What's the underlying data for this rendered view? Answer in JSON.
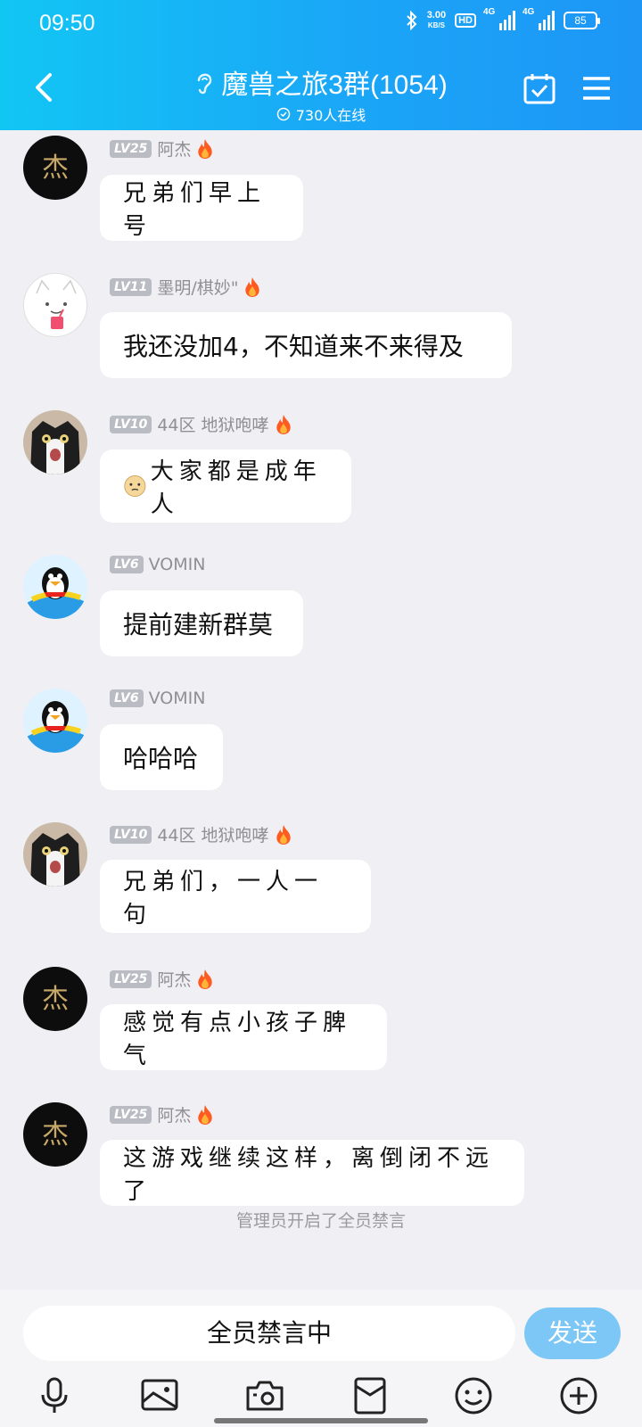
{
  "status_bar": {
    "time": "09:50",
    "speed": "3.00",
    "speed_unit": "KB/S",
    "hd": "HD",
    "net1": "4G",
    "net2": "4G",
    "battery": "85"
  },
  "header": {
    "title": "魔兽之旅3群(1054)",
    "online": "730人在线"
  },
  "messages": [
    {
      "level": "LV25",
      "name": "阿杰",
      "text": "兄弟们早上号",
      "style": "handwriting"
    },
    {
      "level": "LV11",
      "name": "墨明/棋妙\"",
      "text": "我还没加4，不知道来不来得及",
      "style": "normal"
    },
    {
      "level": "LV10",
      "name": "44区 地狱咆哮",
      "text": "大家都是成年人",
      "style": "handwriting"
    },
    {
      "level": "LV6",
      "name": "VOMIN",
      "text": "提前建新群莫",
      "style": "normal"
    },
    {
      "level": "LV6",
      "name": "VOMIN",
      "text": "哈哈哈",
      "style": "normal"
    },
    {
      "level": "LV10",
      "name": "44区 地狱咆哮",
      "text": "兄弟们，一人一句",
      "style": "handwriting"
    },
    {
      "level": "LV25",
      "name": "阿杰",
      "text": "感觉有点小孩子脾气",
      "style": "handwriting"
    },
    {
      "level": "LV25",
      "name": "阿杰",
      "text": "这游戏继续这样，离倒闭不远了",
      "style": "handwriting"
    }
  ],
  "system_notice": "管理员开启了全员禁言",
  "input": {
    "muted_text": "全员禁言中",
    "send_label": "发送"
  },
  "avatar_logo_text": "杰",
  "colors": {
    "header_start": "#12c6f4",
    "header_end": "#1d96f6",
    "send_button": "#7cc7f6",
    "level_badge": "#b9bcc3",
    "fire": "#ff5a1f"
  },
  "toolbar_icons": [
    "microphone-icon",
    "image-icon",
    "camera-icon",
    "red-packet-icon",
    "emoji-icon",
    "plus-icon"
  ]
}
